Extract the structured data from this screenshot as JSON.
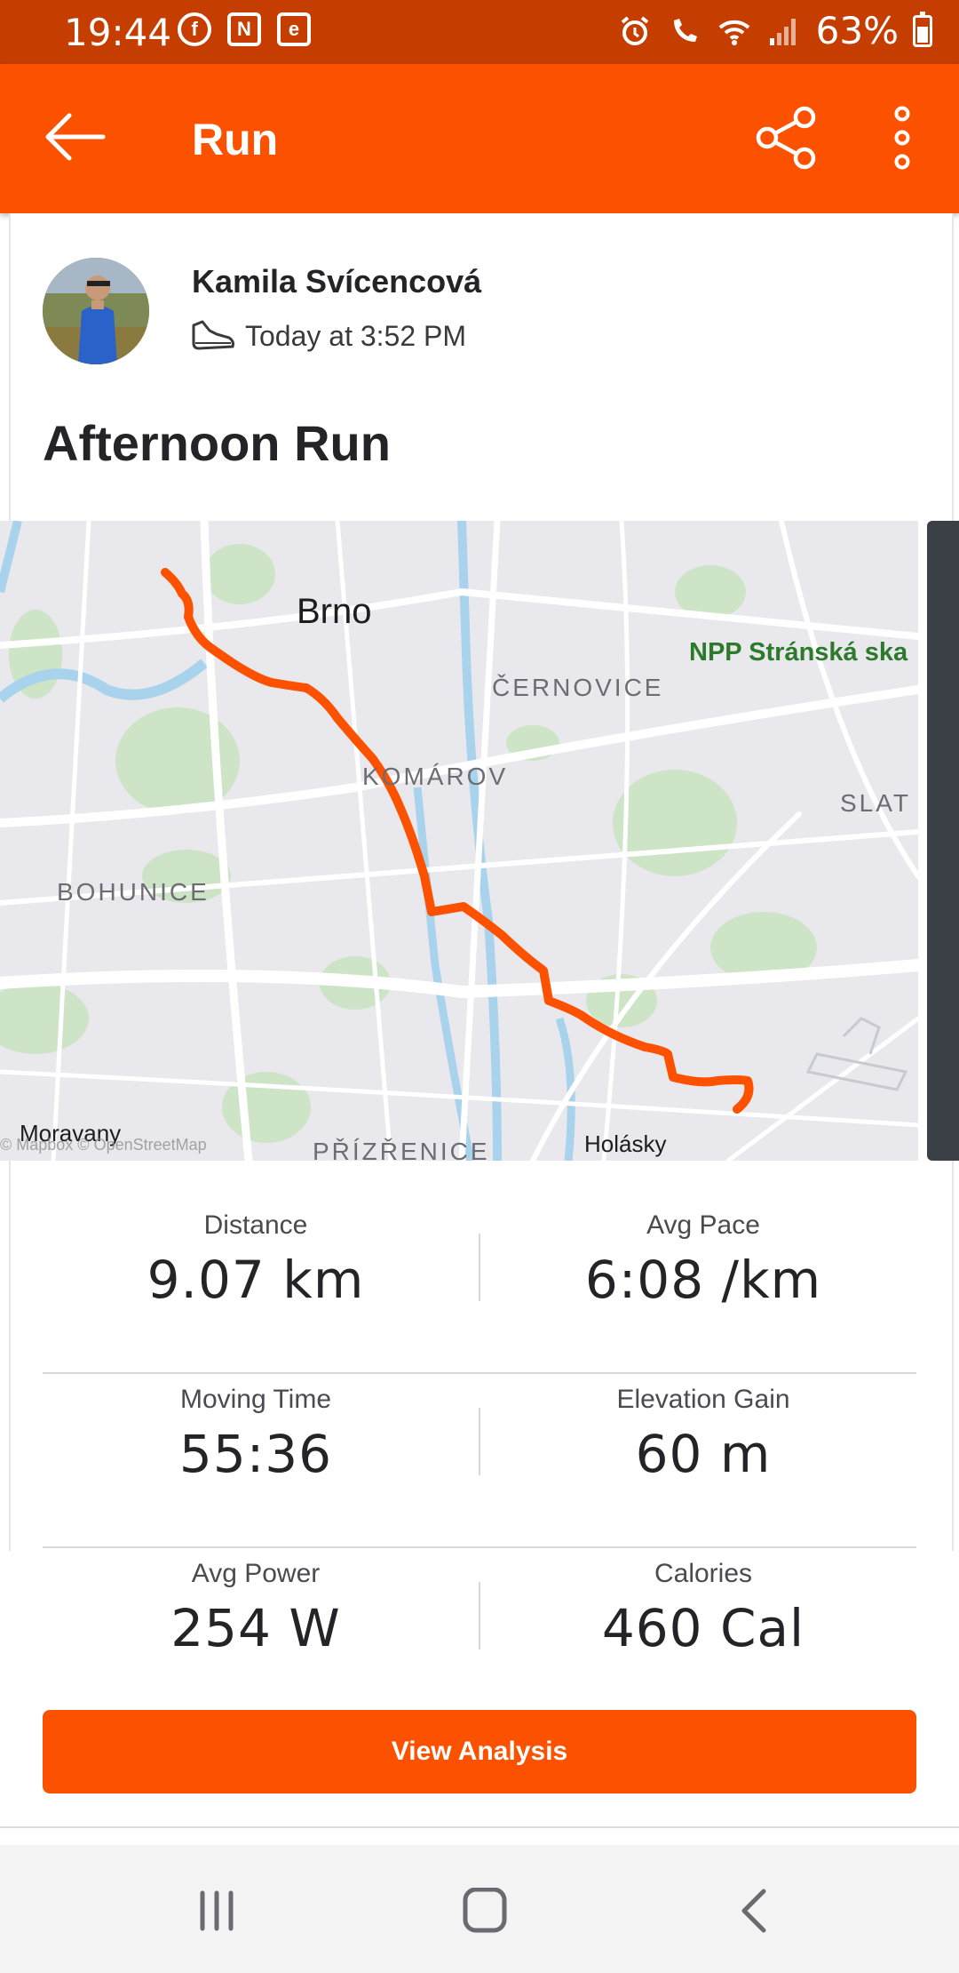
{
  "status_bar": {
    "time": "19:44",
    "notification_icons": [
      "facebook-icon",
      "news-icon",
      "e-icon"
    ],
    "battery": "63%",
    "status_icons": [
      "alarm-icon",
      "wifi-call-icon",
      "wifi-icon",
      "signal-icon",
      "battery-icon"
    ]
  },
  "app_bar": {
    "title": "Run",
    "color": "#fc5200"
  },
  "athlete": {
    "name": "Kamila Svícencová",
    "time": "Today at 3:52 PM"
  },
  "activity": {
    "title": "Afternoon Run"
  },
  "map": {
    "labels": {
      "brno": "Brno",
      "npp": "NPP Stránská ska",
      "cernovice": "ČERNOVICE",
      "komarov": "KOMÁROV",
      "slat": "SLAT",
      "bohunice": "BOHUNICE",
      "moravany": "Moravany",
      "attribution": "© Mapbox © OpenStreetMap",
      "prizrenice": "PŘÍZŘENICE",
      "holasky": "Holásky"
    },
    "route_color": "#fc5200"
  },
  "stats": [
    {
      "left": {
        "label": "Distance",
        "value": "9.07 km"
      },
      "right": {
        "label": "Avg Pace",
        "value": "6:08 /km"
      }
    },
    {
      "left": {
        "label": "Moving Time",
        "value": "55:36"
      },
      "right": {
        "label": "Elevation Gain",
        "value": "60 m"
      }
    },
    {
      "left": {
        "label": "Avg Power",
        "value": "254 W"
      },
      "right": {
        "label": "Calories",
        "value": "460 Cal"
      }
    }
  ],
  "view_analysis_label": "View Analysis",
  "nav_bar": [
    "recent-apps-icon",
    "home-icon",
    "back-icon"
  ]
}
